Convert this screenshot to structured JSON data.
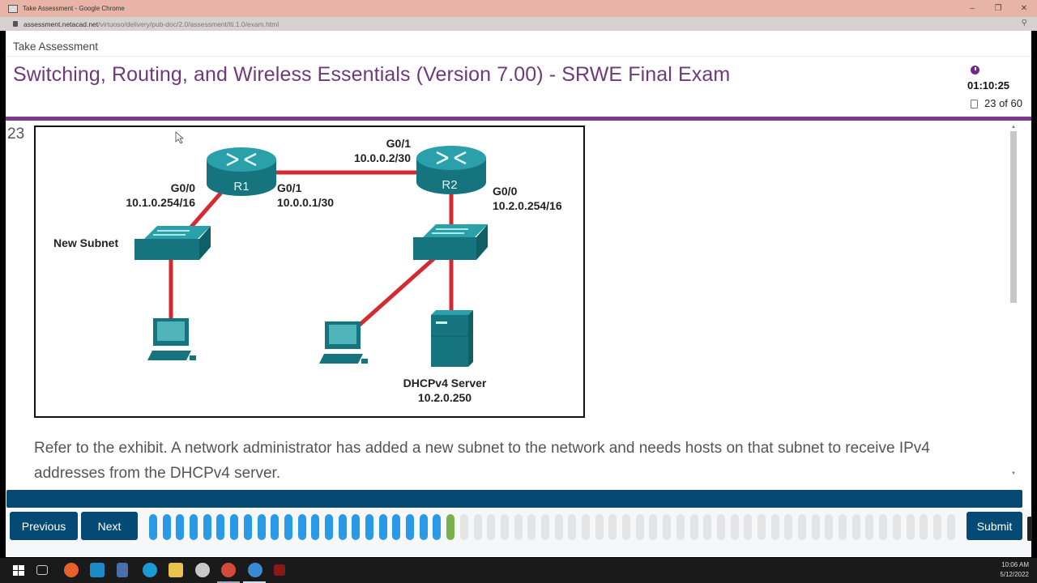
{
  "browser": {
    "window_title": "Take Assessment - Google Chrome",
    "url_domain": "assessment.netacad.net",
    "url_path": "/virtuoso/delivery/pub-doc/2.0/assessment/lti.1.0/exam.html",
    "controls": {
      "minimize": "–",
      "restore": "❐",
      "close": "✕"
    }
  },
  "header": {
    "breadcrumb": "Take Assessment",
    "exam_title": "Switching, Routing, and Wireless Essentials (Version 7.00) - SRWE Final Exam",
    "timer": "01:10:25",
    "page_count": "23 of 60"
  },
  "question": {
    "number": "23",
    "text": "Refer to the exhibit. A network administrator has added a new subnet to the network and needs hosts on that subnet to receive IPv4 addresses from the DHCPv4 server."
  },
  "exhibit": {
    "r1": {
      "name": "R1",
      "g00_iface": "G0/0",
      "g00_ip": "10.1.0.254/16",
      "g01_iface": "G0/1",
      "g01_ip": "10.0.0.1/30"
    },
    "r2": {
      "name": "R2",
      "g01_iface": "G0/1",
      "g01_ip": "10.0.0.2/30",
      "g00_iface": "G0/0",
      "g00_ip": "10.2.0.254/16"
    },
    "new_subnet_label": "New Subnet",
    "server_label": "DHCPv4 Server",
    "server_ip": "10.2.0.250",
    "colors": {
      "device": "#1d8a94",
      "link": "#d42a32"
    }
  },
  "navigation": {
    "previous_label": "Previous",
    "next_label": "Next",
    "submit_label": "Submit",
    "total_questions": 60,
    "answered": 22,
    "current": 23,
    "colors": {
      "answered": "#2a9ae6",
      "current": "#78b04a",
      "unanswered": "#e4e4e4"
    }
  },
  "taskbar": {
    "time": "10:06 AM",
    "date": "5/12/2022",
    "apps": [
      "windows-start",
      "task-view",
      "firefox",
      "app-circle",
      "network-app",
      "edge",
      "file-explorer",
      "cloud-app",
      "chrome-profile",
      "chrome",
      "red-app"
    ]
  }
}
